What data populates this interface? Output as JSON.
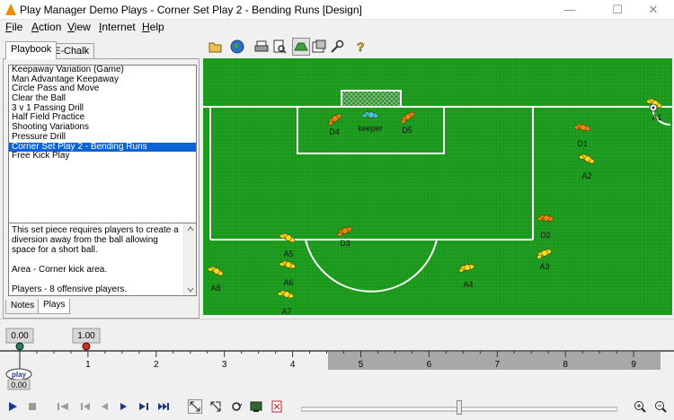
{
  "window": {
    "title": "Play Manager Demo Plays - Corner Set Play 2 - Bending Runs [Design]",
    "minimize": "—",
    "maximize": "☐",
    "close": "✕"
  },
  "menu": [
    {
      "label": "File",
      "accel": "F",
      "rest": "ile"
    },
    {
      "label": "Action",
      "accel": "A",
      "rest": "ction"
    },
    {
      "label": "View",
      "accel": "V",
      "rest": "iew"
    },
    {
      "label": "Internet",
      "accel": "I",
      "rest": "nternet"
    },
    {
      "label": "Help",
      "accel": "H",
      "rest": "elp"
    }
  ],
  "left_panel": {
    "tabs": [
      "Playbook",
      "E-Chalk"
    ],
    "plays": [
      "Keepaway Variation (Game)",
      "Man Advantage Keepaway",
      "Circle Pass and Move",
      "Clear the Ball",
      "3 v 1 Passing Drill",
      "Half Field Practice",
      "Shooting Variations",
      "Pressure Drill",
      "Corner Set Play 2 - Bending Runs",
      "Free Kick Play"
    ],
    "selected_index": 8,
    "description": [
      "This set piece requires players to create a diversion away from the ball allowing space for a short ball.",
      "Area - Corner kick area.",
      "Players - 8 offensive players."
    ],
    "bottom_tabs": [
      "Notes",
      "Plays"
    ]
  },
  "toolbar": {
    "icons": [
      "open-folder-icon",
      "globe-icon",
      "print-icon",
      "print-preview-icon",
      "field-view-icon",
      "properties-icon",
      "tools-icon",
      "help-icon"
    ]
  },
  "field": {
    "players": [
      {
        "label": "D4",
        "team": "defense"
      },
      {
        "label": "keeper",
        "team": "keeper"
      },
      {
        "label": "D5",
        "team": "defense"
      },
      {
        "label": "D1",
        "team": "defense"
      },
      {
        "label": "D3",
        "team": "defense"
      },
      {
        "label": "D2",
        "team": "defense"
      },
      {
        "label": "A1",
        "team": "offense"
      },
      {
        "label": "A2",
        "team": "offense"
      },
      {
        "label": "A3",
        "team": "offense"
      },
      {
        "label": "A4",
        "team": "offense"
      },
      {
        "label": "A5",
        "team": "offense"
      },
      {
        "label": "A6",
        "team": "offense"
      },
      {
        "label": "A7",
        "team": "offense"
      },
      {
        "label": "A8",
        "team": "offense"
      }
    ],
    "colors": {
      "grass": "#1e9b1e",
      "defense": "#e08a10",
      "offense": "#f0e020",
      "keeper": "#30d0e0",
      "lines": "#ffffff"
    }
  },
  "timeline": {
    "start_marker": "0.00",
    "current_marker": "1.00",
    "ticks": [
      "1",
      "2",
      "3",
      "4",
      "5",
      "6",
      "7",
      "8",
      "9"
    ],
    "play_label": "play",
    "play_time": "0.00"
  },
  "controls": {
    "icons": [
      "play-icon",
      "stop-icon",
      "first-frame-icon",
      "prev-step-icon",
      "prev-frame-icon",
      "next-frame-icon",
      "next-step-icon",
      "last-frame-icon",
      "select-move-icon",
      "resize-icon",
      "loop-icon",
      "record-icon",
      "delete-frame-icon",
      "zoom-in-icon",
      "zoom-out-icon"
    ],
    "speed_level": 0.5
  }
}
